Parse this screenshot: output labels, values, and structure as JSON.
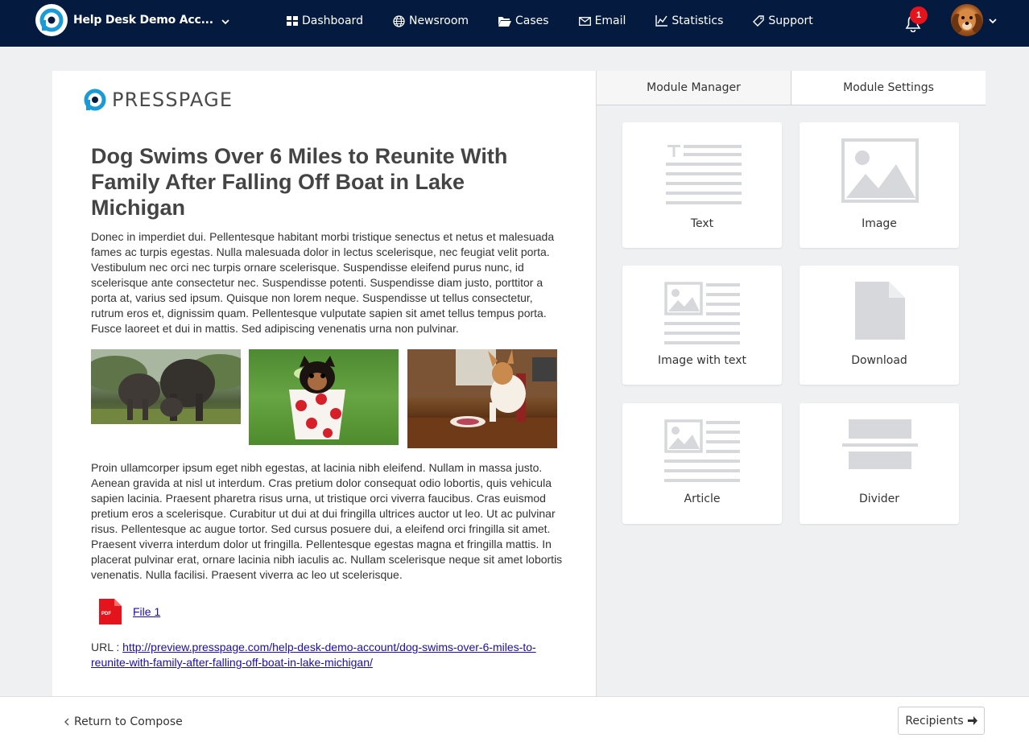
{
  "header": {
    "account_name": "Help Desk Demo Acc...",
    "nav": [
      {
        "label": "Dashboard",
        "icon": "grid-icon"
      },
      {
        "label": "Newsroom",
        "icon": "globe-icon"
      },
      {
        "label": "Cases",
        "icon": "folder-icon"
      },
      {
        "label": "Email",
        "icon": "envelope-icon"
      },
      {
        "label": "Statistics",
        "icon": "chart-icon"
      },
      {
        "label": "Support",
        "icon": "support-icon"
      }
    ],
    "notification_count": "1"
  },
  "editor": {
    "logo_text": "PRESSPAGE",
    "headline": "Dog Swims Over 6 Miles to Reunite With Family After Falling Off Boat in Lake Michigan",
    "paragraph_1": "Donec in imperdiet dui. Pellentesque habitant morbi tristique senectus et netus et malesuada fames ac turpis egestas. Nulla malesuada dolor in lectus scelerisque, nec feugiat velit porta. Vestibulum nec orci nec turpis ornare scelerisque. Suspendisse eleifend purus nunc, id scelerisque ante consectetur nec. Suspendisse potenti. Suspendisse diam justo, porttitor a porta at, varius sed ipsum. Quisque non lorem neque. Suspendisse ut tellus consectetur, rutrum eros et, dignissim quam. Pellentesque vulputate sapien sit amet tellus tempus porta. Fusce laoreet et dui in mattis. Sed adipiscing venenatis urna non pulvinar.",
    "paragraph_2": "Proin ullamcorper ipsum eget nibh egestas, at lacinia nibh eleifend. Nullam in massa justo. Aenean gravida at nisl ut interdum. Cras pretium dolor consequat odio lobortis, quis vehicula sapien lacinia. Praesent pharetra risus urna, ut tristique orci viverra faucibus. Cras euismod pretium eros a scelerisque. Curabitur ut dui at dui fringilla ultrices auctor ut leo. Ut ac pulvinar risus. Pellentesque ac augue tortor. Sed cursus posuere dui, a eleifend orci fringilla sit amet. Praesent viverra interdum dolor ut fringilla. Pellentesque egestas magna et fringilla mattis. In placerat pulvinar erat, ornare lacinia nibh iaculis ac. Nullam scelerisque neque sit amet lobortis venenatis. Nulla facilisi. Praesent viverra ac leo ut scelerisque.",
    "file_icon_text": "PDF",
    "file_label": "File 1",
    "url_label": "URL : ",
    "url": "http://preview.presspage.com/help-desk-demo-account/dog-swims-over-6-miles-to-reunite-with-family-after-falling-off-boat-in-lake-michigan/"
  },
  "panel": {
    "tabs": [
      "Module Manager",
      "Module Settings"
    ],
    "modules": [
      "Text",
      "Image",
      "Image with text",
      "Download",
      "Article",
      "Divider"
    ]
  },
  "footer": {
    "return_label": "Return to Compose",
    "recipients_label": "Recipients"
  },
  "colors": {
    "navbar": "#041b3f",
    "presspage_blue": "#1a9bd7",
    "badge": "#e3141b",
    "pdf_red": "#e3141b",
    "link": "#1a0dab"
  }
}
